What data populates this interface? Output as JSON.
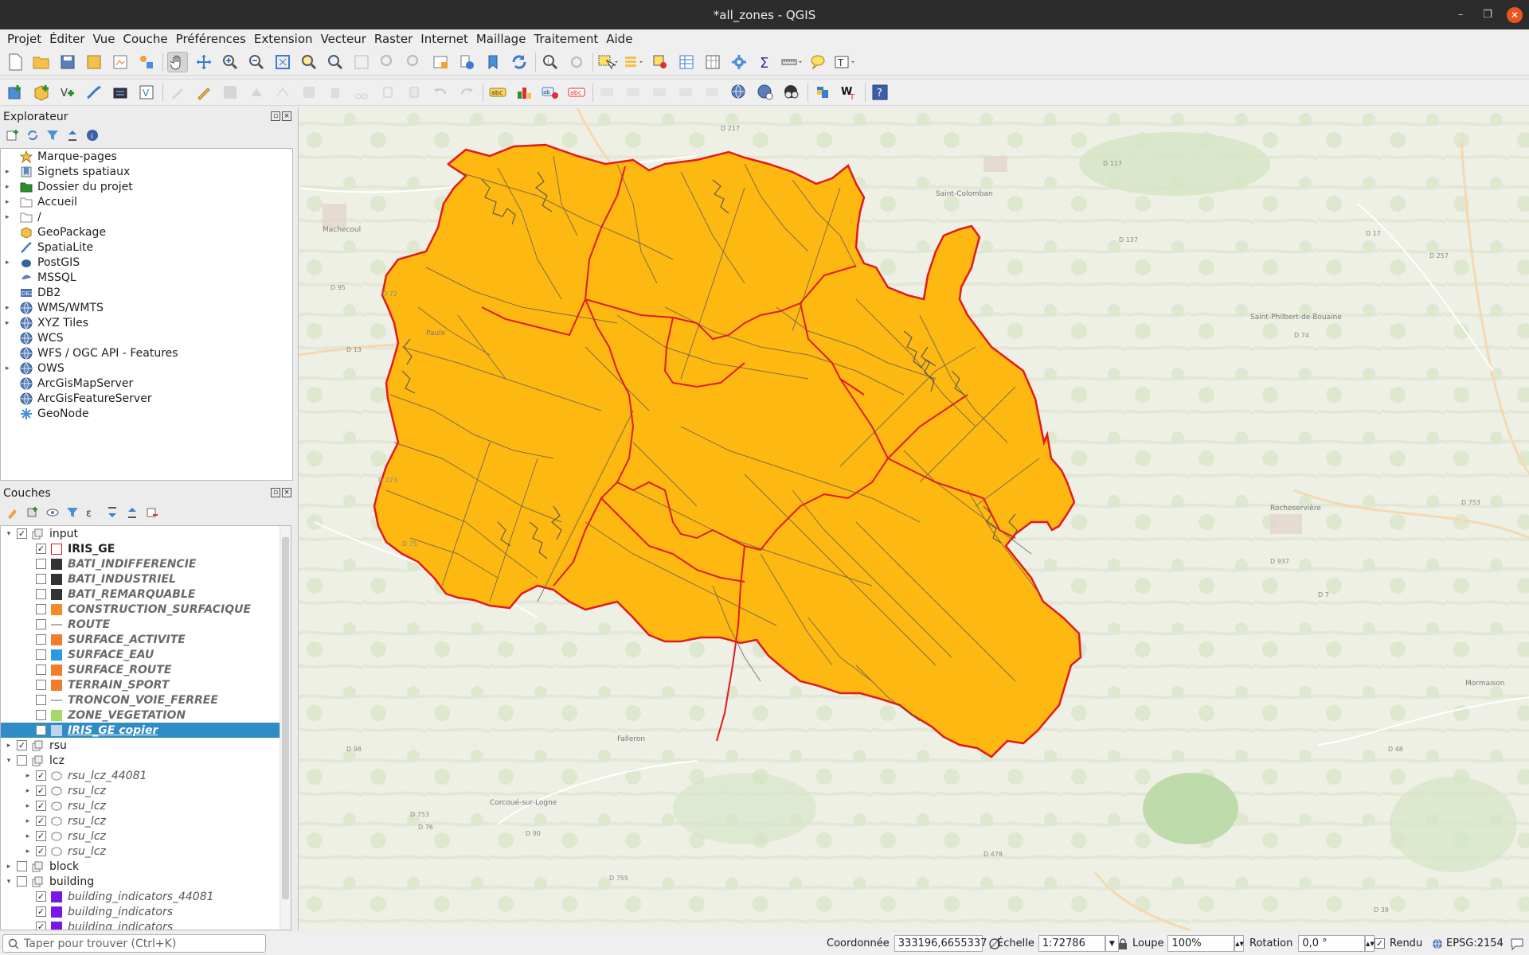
{
  "window": {
    "title": "*all_zones - QGIS"
  },
  "menubar": [
    "Projet",
    "Éditer",
    "Vue",
    "Couche",
    "Préférences",
    "Extension",
    "Vecteur",
    "Raster",
    "Internet",
    "Maillage",
    "Traitement",
    "Aide"
  ],
  "browser": {
    "title": "Explorateur",
    "items": [
      {
        "label": "Marque-pages",
        "expandable": false,
        "icon": "star-icon"
      },
      {
        "label": "Signets spatiaux",
        "expandable": true,
        "icon": "bookmark-icon"
      },
      {
        "label": "Dossier du projet",
        "expandable": true,
        "icon": "project-folder-icon"
      },
      {
        "label": "Accueil",
        "expandable": true,
        "icon": "home-folder-icon"
      },
      {
        "label": "/",
        "expandable": true,
        "icon": "root-folder-icon"
      },
      {
        "label": "GeoPackage",
        "expandable": false,
        "icon": "geopackage-icon"
      },
      {
        "label": "SpatiaLite",
        "expandable": false,
        "icon": "spatialite-icon"
      },
      {
        "label": "PostGIS",
        "expandable": true,
        "icon": "postgis-icon"
      },
      {
        "label": "MSSQL",
        "expandable": false,
        "icon": "mssql-icon"
      },
      {
        "label": "DB2",
        "expandable": false,
        "icon": "db2-icon"
      },
      {
        "label": "WMS/WMTS",
        "expandable": true,
        "icon": "globe-icon"
      },
      {
        "label": "XYZ Tiles",
        "expandable": true,
        "icon": "globe-icon"
      },
      {
        "label": "WCS",
        "expandable": false,
        "icon": "globe-icon"
      },
      {
        "label": "WFS / OGC API - Features",
        "expandable": false,
        "icon": "globe-icon"
      },
      {
        "label": "OWS",
        "expandable": true,
        "icon": "globe-icon"
      },
      {
        "label": "ArcGisMapServer",
        "expandable": false,
        "icon": "globe-icon"
      },
      {
        "label": "ArcGisFeatureServer",
        "expandable": false,
        "icon": "globe-icon"
      },
      {
        "label": "GeoNode",
        "expandable": false,
        "icon": "geonode-icon"
      }
    ]
  },
  "layers_panel": {
    "title": "Couches",
    "rows": [
      {
        "kind": "group",
        "indent": 0,
        "expanded": true,
        "checked": true,
        "label": "input",
        "style": "normal"
      },
      {
        "kind": "layer",
        "indent": 1,
        "checked": true,
        "label": "IRIS_GE",
        "swatch": "#ffffff",
        "outline": "#e31a1c",
        "style": "bold"
      },
      {
        "kind": "layer",
        "indent": 1,
        "checked": false,
        "label": "BATI_INDIFFERENCIE",
        "swatch": "#333333",
        "style": "grey-italic"
      },
      {
        "kind": "layer",
        "indent": 1,
        "checked": false,
        "label": "BATI_INDUSTRIEL",
        "swatch": "#333333",
        "style": "grey-italic"
      },
      {
        "kind": "layer",
        "indent": 1,
        "checked": false,
        "label": "BATI_REMARQUABLE",
        "swatch": "#333333",
        "style": "grey-italic"
      },
      {
        "kind": "layer",
        "indent": 1,
        "checked": false,
        "label": "CONSTRUCTION_SURFACIQUE",
        "swatch": "#f28c28",
        "style": "grey-italic"
      },
      {
        "kind": "layer",
        "indent": 1,
        "checked": false,
        "label": "ROUTE",
        "swatch": "line",
        "style": "grey-italic"
      },
      {
        "kind": "layer",
        "indent": 1,
        "checked": false,
        "label": "SURFACE_ACTIVITE",
        "swatch": "#f27c2c",
        "style": "grey-italic"
      },
      {
        "kind": "layer",
        "indent": 1,
        "checked": false,
        "label": "SURFACE_EAU",
        "swatch": "#2b9ae0",
        "style": "grey-italic"
      },
      {
        "kind": "layer",
        "indent": 1,
        "checked": false,
        "label": "SURFACE_ROUTE",
        "swatch": "#f27c2c",
        "style": "grey-italic"
      },
      {
        "kind": "layer",
        "indent": 1,
        "checked": false,
        "label": "TERRAIN_SPORT",
        "swatch": "#f27c2c",
        "style": "grey-italic"
      },
      {
        "kind": "layer",
        "indent": 1,
        "checked": false,
        "label": "TRONCON_VOIE_FERREE",
        "swatch": "line",
        "style": "grey-italic"
      },
      {
        "kind": "layer",
        "indent": 1,
        "checked": false,
        "label": "ZONE_VEGETATION",
        "swatch": "#a6d96a",
        "style": "grey-italic"
      },
      {
        "kind": "layer",
        "indent": 1,
        "checked": false,
        "label": "IRIS_GE copier",
        "swatch": "#bcd4ee",
        "style": "selected"
      },
      {
        "kind": "group",
        "indent": 0,
        "expanded": false,
        "checked": true,
        "label": "rsu",
        "style": "normal"
      },
      {
        "kind": "group",
        "indent": 0,
        "expanded": true,
        "checked": false,
        "label": "lcz",
        "style": "normal"
      },
      {
        "kind": "layer",
        "indent": 1,
        "expandable": true,
        "checked": true,
        "label": "rsu_lcz_44081",
        "swatch": "polygon",
        "style": "italic"
      },
      {
        "kind": "layer",
        "indent": 1,
        "expandable": true,
        "checked": true,
        "label": "rsu_lcz",
        "swatch": "polygon",
        "style": "italic"
      },
      {
        "kind": "layer",
        "indent": 1,
        "expandable": true,
        "checked": true,
        "label": "rsu_lcz",
        "swatch": "polygon",
        "style": "italic"
      },
      {
        "kind": "layer",
        "indent": 1,
        "expandable": true,
        "checked": true,
        "label": "rsu_lcz",
        "swatch": "polygon",
        "style": "italic"
      },
      {
        "kind": "layer",
        "indent": 1,
        "expandable": true,
        "checked": true,
        "label": "rsu_lcz",
        "swatch": "polygon",
        "style": "italic"
      },
      {
        "kind": "layer",
        "indent": 1,
        "expandable": true,
        "checked": true,
        "label": "rsu_lcz",
        "swatch": "polygon",
        "style": "italic"
      },
      {
        "kind": "group",
        "indent": 0,
        "expanded": false,
        "checked": false,
        "label": "block",
        "style": "normal"
      },
      {
        "kind": "group",
        "indent": 0,
        "expanded": true,
        "checked": false,
        "label": "building",
        "style": "normal"
      },
      {
        "kind": "layer",
        "indent": 1,
        "checked": true,
        "label": "building_indicators_44081",
        "swatch": "#7a17e6",
        "style": "italic"
      },
      {
        "kind": "layer",
        "indent": 1,
        "checked": true,
        "label": "building_indicators",
        "swatch": "#7a17e6",
        "style": "italic"
      },
      {
        "kind": "layer",
        "indent": 1,
        "checked": true,
        "label": "building_indicators",
        "swatch": "#7a17e6",
        "style": "italic"
      }
    ]
  },
  "map": {
    "place_labels": [
      "Saint-Colomban",
      "Saint-Philbert-de-Bouaine",
      "Machecoul",
      "Paulx",
      "Falleron",
      "Corcoué-sur-Logne",
      "Rocheservière",
      "Mormaison"
    ],
    "road_labels": [
      "D 217",
      "D 117",
      "D 17",
      "D 137",
      "D 257",
      "D 72",
      "D 95",
      "D 13",
      "D 74",
      "D 273",
      "D 75",
      "D 753",
      "D 76",
      "D 90",
      "D 98",
      "D 755",
      "D 937",
      "D 7",
      "D 48",
      "D 39",
      "D 478",
      "D 753"
    ],
    "fill_color": "#fdb912",
    "boundary_color": "#e31a1c",
    "network_color": "#555555"
  },
  "statusbar": {
    "search_placeholder": "Taper pour trouver (Ctrl+K)",
    "coord_label": "Coordonnée",
    "coord_value": "333196,6655337",
    "scale_label": "Échelle",
    "scale_value": "1:72786",
    "magnifier_label": "Loupe",
    "magnifier_value": "100%",
    "rotation_label": "Rotation",
    "rotation_value": "0,0 °",
    "render_label": "Rendu",
    "crs": "EPSG:2154"
  }
}
